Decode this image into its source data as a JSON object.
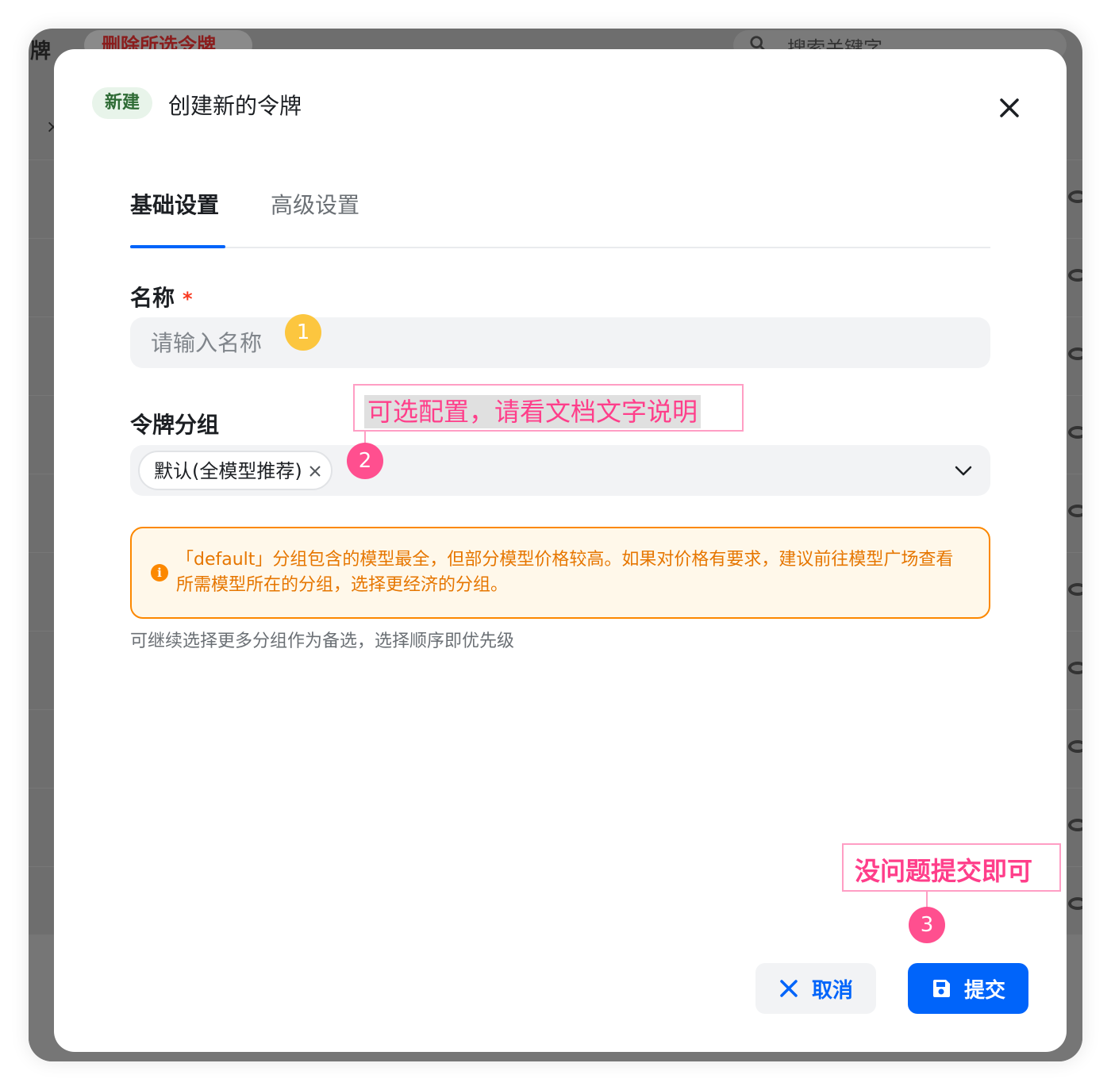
{
  "background": {
    "left_text": "牌",
    "delete_button": "删除所选令牌",
    "search_placeholder": "搜索关键字",
    "left_x": "×",
    "row_count": 10
  },
  "modal": {
    "badge": "新建",
    "title": "创建新的令牌",
    "tabs": [
      {
        "label": "基础设置",
        "active": true
      },
      {
        "label": "高级设置",
        "active": false
      }
    ],
    "name_field": {
      "label": "名称",
      "required_mark": "*",
      "placeholder": "请输入名称",
      "value": ""
    },
    "group_field": {
      "label": "令牌分组",
      "selected_tag": "默认(全模型推荐)"
    },
    "warning": {
      "icon": "info-icon",
      "text": "「default」分组包含的模型最全，但部分模型价格较高。如果对价格有要求，建议前往模型广场查看所需模型所在的分组，选择更经济的分组。"
    },
    "hint": "可继续选择更多分组作为备选，选择顺序即优先级",
    "buttons": {
      "cancel": "取消",
      "submit": "提交"
    }
  },
  "annotations": {
    "step1": "1",
    "step2": "2",
    "step3": "3",
    "step2_note": "可选配置，请看文档文字说明",
    "step3_note": "没问题提交即可"
  },
  "colors": {
    "primary": "#0064fa",
    "warning": "#fc8800",
    "annotation_pink": "#ff4f8f",
    "annotation_yellow": "#fcc63f",
    "badge_green": "#2e6b35"
  }
}
